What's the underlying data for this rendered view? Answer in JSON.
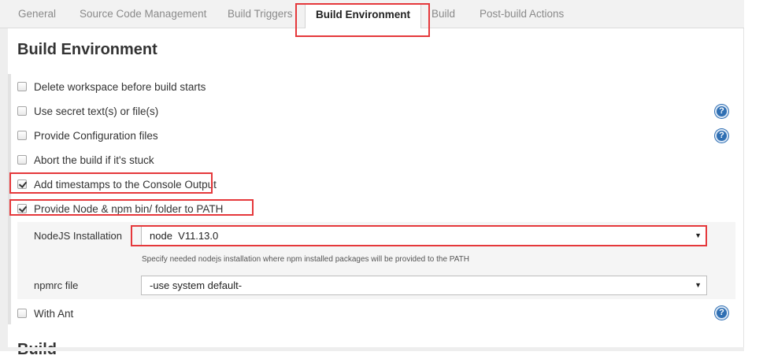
{
  "tabs": [
    {
      "label": "General"
    },
    {
      "label": "Source Code Management"
    },
    {
      "label": "Build Triggers"
    },
    {
      "label": "Build Environment",
      "active": true
    },
    {
      "label": "Build"
    },
    {
      "label": "Post-build Actions"
    }
  ],
  "section": {
    "title": "Build Environment",
    "options": [
      {
        "label": "Delete workspace before build starts",
        "checked": false
      },
      {
        "label": "Use secret text(s) or file(s)",
        "checked": false,
        "help": true
      },
      {
        "label": "Provide Configuration files",
        "checked": false,
        "help": true
      },
      {
        "label": "Abort the build if it's stuck",
        "checked": false
      },
      {
        "label": "Add timestamps to the Console Output",
        "checked": true
      },
      {
        "label": "Provide Node & npm bin/ folder to PATH",
        "checked": true
      },
      {
        "label": "With Ant",
        "checked": false,
        "help": true
      }
    ],
    "nodejs": {
      "installation_label": "NodeJS Installation",
      "installation_value": "node  V11.13.0",
      "hint": "Specify needed nodejs installation where npm installed packages will be provided to the PATH",
      "npmrc_label": "npmrc file",
      "npmrc_value": "-use system default-"
    }
  },
  "next_section_title": "Build",
  "help_glyph": "?",
  "dropdown_glyph": "▼",
  "colors": {
    "highlight": "#e5383b",
    "help_icon": "#2f6fb3"
  }
}
